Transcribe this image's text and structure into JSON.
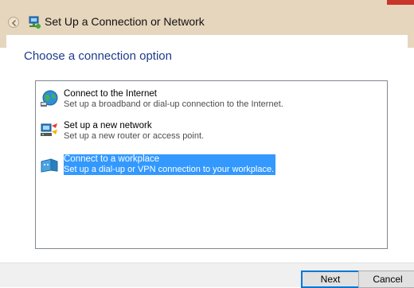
{
  "window": {
    "title": "Set Up a Connection or Network",
    "icons": {
      "back": "back-arrow-icon",
      "title": "network-setup-icon",
      "close": "close-icon"
    }
  },
  "main": {
    "heading": "Choose a connection option",
    "options": [
      {
        "name": "Connect to the Internet",
        "description": "Set up a broadband or dial-up connection to the Internet.",
        "icon": "globe-icon",
        "selected": false
      },
      {
        "name": "Set up a new network",
        "description": "Set up a new router or access point.",
        "icon": "router-icon",
        "selected": false
      },
      {
        "name": "Connect to a workplace",
        "description": "Set up a dial-up or VPN connection to your workplace.",
        "icon": "workplace-icon",
        "selected": true
      }
    ]
  },
  "footer": {
    "next_label": "Next",
    "cancel_label": "Cancel"
  },
  "colors": {
    "frame": "#e6d6bd",
    "heading": "#1e3a8a",
    "selection": "#3399ff",
    "close": "#c7352b"
  }
}
